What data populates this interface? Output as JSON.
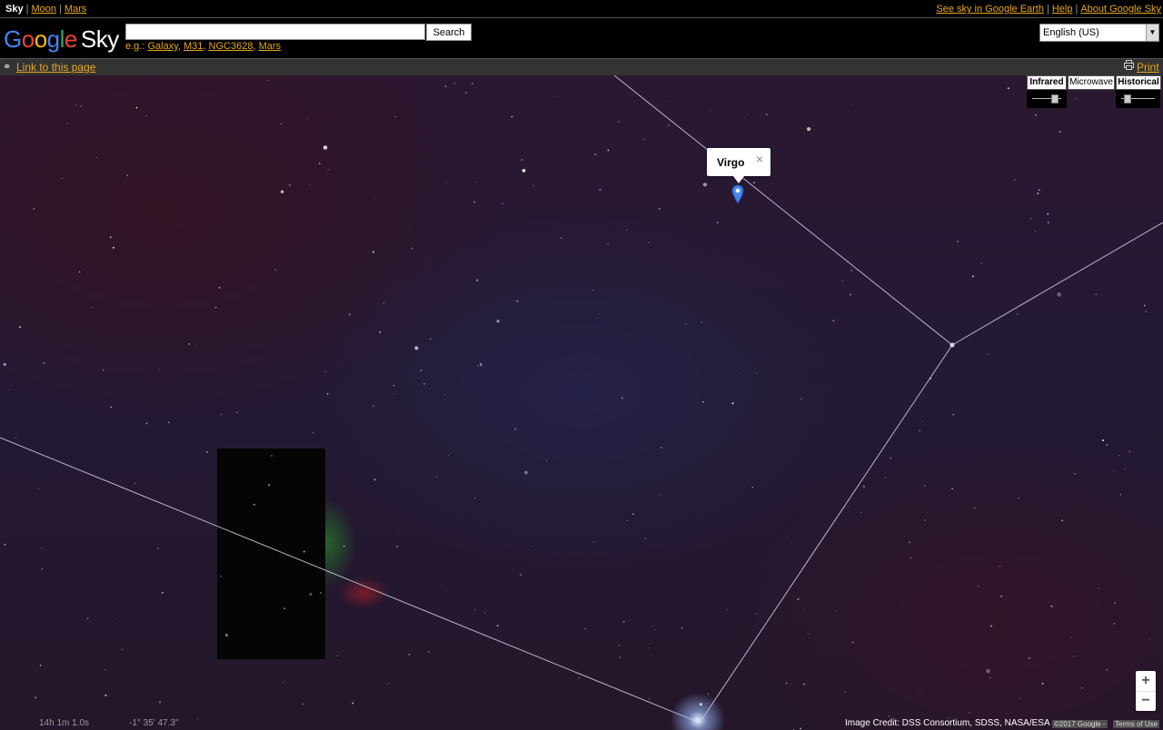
{
  "topnav": {
    "left": [
      {
        "label": "Sky",
        "current": true
      },
      {
        "label": "Moon"
      },
      {
        "label": "Mars"
      }
    ],
    "right": [
      {
        "label": "See sky in Google Earth"
      },
      {
        "label": "Help"
      },
      {
        "label": "About Google Sky"
      }
    ]
  },
  "logo": {
    "word": "Google",
    "product": "Sky"
  },
  "search": {
    "value": "",
    "button_label": "Search",
    "examples_prefix": "e.g.:",
    "examples": [
      "Galaxy",
      "M31",
      "NGC3628",
      "Mars"
    ]
  },
  "language": {
    "selected": "English (US)"
  },
  "linkbar": {
    "link_label": "Link to this page",
    "print_label": "Print"
  },
  "layers": {
    "infrared": "Infrared",
    "microwave": "Microwave",
    "historical": "Historical",
    "infrared_slider": 0.8,
    "historical_slider": 0.1
  },
  "infowindow": {
    "title": "Virgo",
    "close": "×"
  },
  "zoom": {
    "in": "+",
    "out": "−"
  },
  "coords": {
    "ra": "14h 1m 1.0s",
    "dec": "-1° 35' 47.3\""
  },
  "footer": {
    "credit": "Image Credit: DSS Consortium, SDSS, NASA/ESA",
    "copyright": "©2017 Google -",
    "terms": "Terms of Use"
  },
  "colors": {
    "link": "#e7a81c",
    "google_blue": "#4285f4",
    "google_red": "#ea4335",
    "google_yellow": "#fbbc05",
    "google_green": "#34a853",
    "marker": "#4a86e8"
  }
}
